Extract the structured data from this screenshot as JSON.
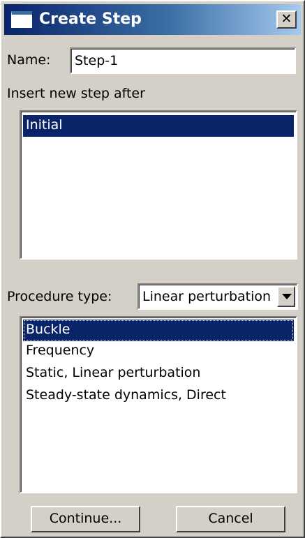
{
  "window": {
    "title": "Create Step",
    "close_label": "✕"
  },
  "form": {
    "name_label": "Name:",
    "name_value": "Step-1",
    "insert_after_label": "Insert new step after",
    "steps": [
      {
        "label": "Initial",
        "selected": true
      }
    ],
    "procedure_type_label": "Procedure type:",
    "procedure_type_value": "Linear perturbation",
    "procedures": [
      {
        "label": "Buckle",
        "selected": true
      },
      {
        "label": "Frequency",
        "selected": false
      },
      {
        "label": "Static, Linear perturbation",
        "selected": false
      },
      {
        "label": "Steady-state dynamics, Direct",
        "selected": false
      }
    ]
  },
  "buttons": {
    "continue_label": "Continue...",
    "cancel_label": "Cancel"
  },
  "colors": {
    "selection": "#0a246a",
    "titlebar_start": "#0a246a",
    "titlebar_end": "#a6caf0",
    "face": "#d4d0c8"
  }
}
